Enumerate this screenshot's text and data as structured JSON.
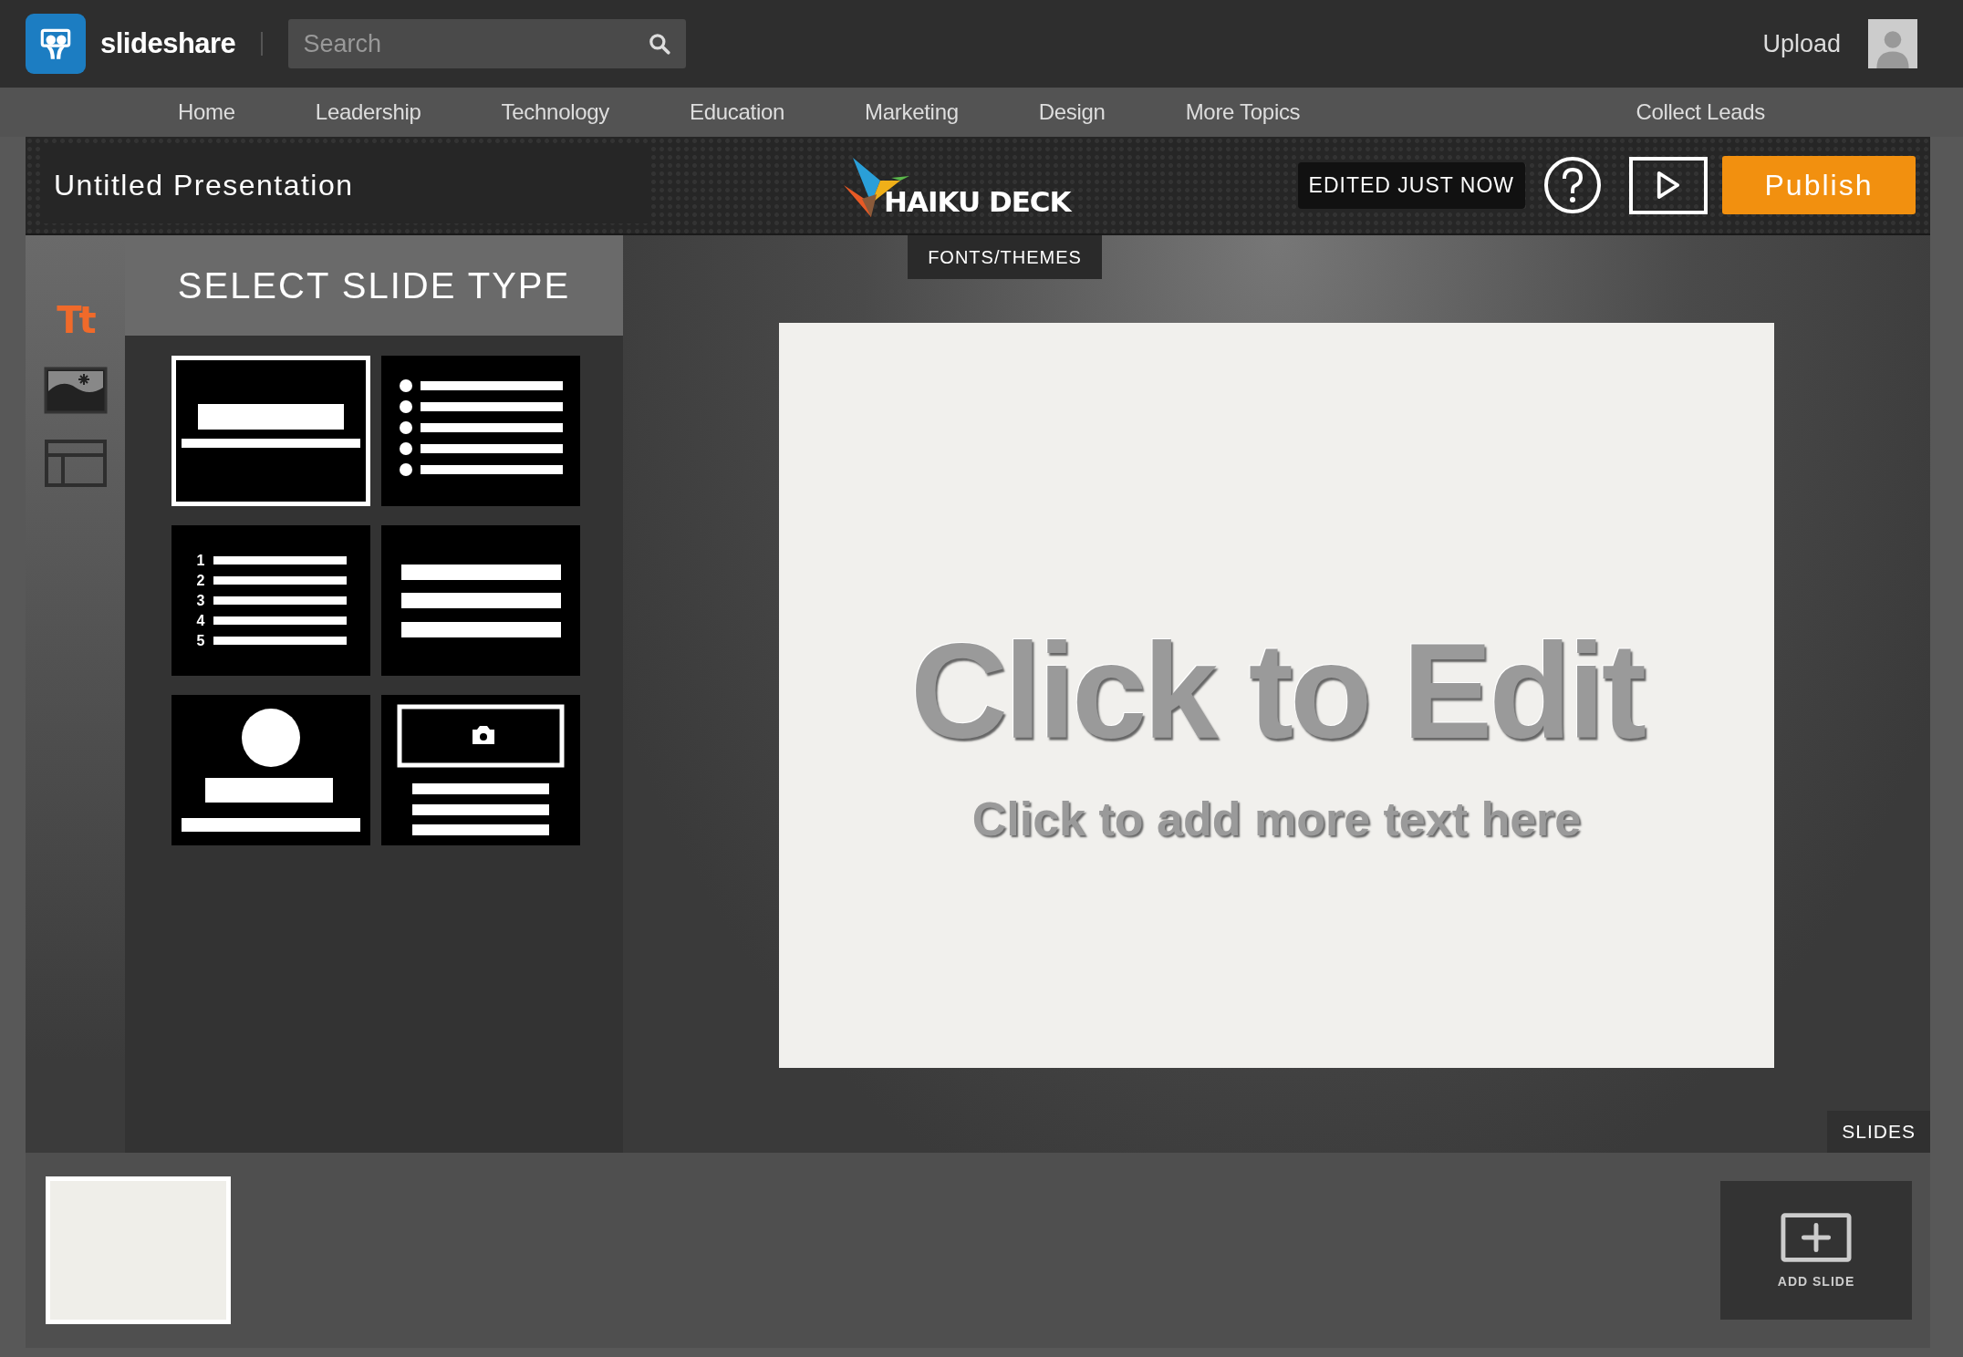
{
  "topbar": {
    "brand": "slideshare",
    "search": {
      "placeholder": "Search"
    },
    "upload": "Upload"
  },
  "nav": {
    "items": [
      "Home",
      "Leadership",
      "Technology",
      "Education",
      "Marketing",
      "Design",
      "More Topics"
    ],
    "right": "Collect Leads"
  },
  "editor": {
    "title": "Untitled Presentation",
    "logo": "HAIKU DECK",
    "status": "EDITED JUST NOW",
    "publish": "Publish"
  },
  "tools": [
    {
      "kind": "text",
      "label": "Tt",
      "selected": true
    },
    {
      "kind": "image",
      "selected": false
    },
    {
      "kind": "layout",
      "selected": false
    }
  ],
  "panel": {
    "title": "SELECT SLIDE TYPE",
    "slide_types": [
      {
        "kind": "title",
        "selected": true
      },
      {
        "kind": "bullets",
        "selected": false
      },
      {
        "kind": "numbered",
        "numbers": [
          "1",
          "2",
          "3",
          "4",
          "5"
        ],
        "selected": false
      },
      {
        "kind": "text",
        "selected": false
      },
      {
        "kind": "profile",
        "selected": false
      },
      {
        "kind": "photo",
        "selected": false
      }
    ]
  },
  "stage": {
    "fonts_tab": "FONTS/THEMES",
    "slide": {
      "title": "Click to Edit",
      "subtitle": "Click to add more text here"
    },
    "slides_label": "SLIDES"
  },
  "slide_strip": {
    "thumbnails": [
      {
        "selected": true
      }
    ],
    "add_slide": "ADD SLIDE"
  }
}
